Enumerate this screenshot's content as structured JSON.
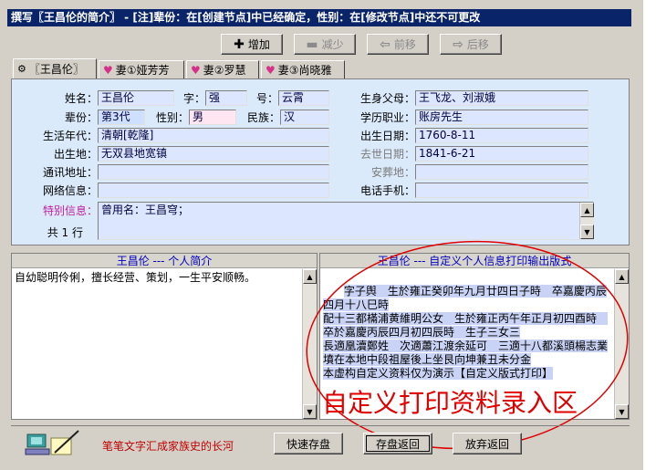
{
  "title": "撰写〖王昌伦的简介〗 - [注]辈份：在[创建节点]中已经确定，性别：在[修改节点]中还不可更改",
  "toolbar": {
    "add": "增加",
    "reduce": "减少",
    "forward": "前移",
    "backward": "后移"
  },
  "tabs": [
    {
      "label": "〖王昌伦〗",
      "icon": "family-icon"
    },
    {
      "label": "妻①娅芳芳",
      "icon": "heart-icon"
    },
    {
      "label": "妻②罗慧",
      "icon": "heart-icon"
    },
    {
      "label": "妻③尚晓雅",
      "icon": "heart-icon"
    }
  ],
  "form": {
    "name_label": "姓名：",
    "name": "王昌伦",
    "zi_label": "字：",
    "zi": "强",
    "hao_label": "号：",
    "hao": "云霄",
    "parents_label": "生身父母：",
    "parents": "王飞龙、刘淑娥",
    "generation_label": "辈份：",
    "generation": "第3代",
    "gender_label": "性别：",
    "gender": "男",
    "ethnic_label": "民族：",
    "ethnic": "汉",
    "education_label": "学历职业：",
    "education": "账房先生",
    "era_label": "生活年代：",
    "era": "清朝[乾隆]",
    "birthdate_label": "出生日期：",
    "birthdate": "1760-8-11",
    "birthplace_label": "出生地：",
    "birthplace": "无双县地宽镇",
    "deathdate_label": "去世日期：",
    "deathdate": "1841-6-21",
    "address_label": "通讯地址：",
    "address": "",
    "burial_label": "安葬地：",
    "burial": "",
    "network_label": "网络信息：",
    "network": "",
    "phone_label": "电话手机：",
    "phone": "",
    "special_label": "特别信息：",
    "special": "曾用名：王昌穹；",
    "lines_label": "共 1 行"
  },
  "left_pane": {
    "header": "王昌伦 --- 个人简介",
    "text": "自幼聪明伶俐，擅长经营、策划，一生平安顺畅。"
  },
  "right_pane": {
    "header": "王昌伦 --- 自定义个人信息打印输出版式",
    "text": "字子舆　生於雍正癸卯年九月廿四日子時　卒嘉慶丙辰四月十八巳時\n配十三都樠浦黄維明公女　生於雍正丙午年正月初四酉時　卒於嘉慶丙辰四月初四辰時　生子三女三\n長適凰瀆鄭姓　次適蕭江渡余延可　三適十八都溪頭楊志業\n墳在本地中段祖屋後上坐艮向坤兼丑未分金\n本虚构自定义资料仅为演示【自定义版式打印】",
    "annotation": "自定义打印资料录入区"
  },
  "footer": {
    "slogan": "笔笔文字汇成家族史的长河",
    "quick_save": "快速存盘",
    "save_return": "存盘返回",
    "discard_return": "放弃返回"
  },
  "colors": {
    "title_bg": "#0a246a",
    "panel_bg": "#dbeafb",
    "highlight_bg": "#c9d3f5",
    "annotation_red": "#e00000",
    "pane_header_text": "#0000c0"
  }
}
